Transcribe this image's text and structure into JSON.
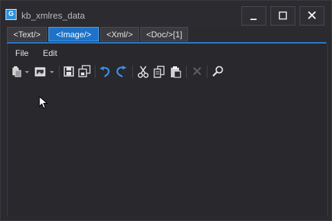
{
  "window": {
    "title": "kb_xmlres_data",
    "app_icon_letter": "G"
  },
  "tabs": [
    {
      "label": "<Text/>",
      "active": false
    },
    {
      "label": "<Image/>",
      "active": true
    },
    {
      "label": "<Xml/>",
      "active": false
    },
    {
      "label": "<Doc/>[1]",
      "active": false
    }
  ],
  "menu": {
    "file": "File",
    "edit": "Edit"
  },
  "toolbar": {
    "icons": [
      "paste-special-icon",
      "insert-image-icon",
      "save-icon",
      "save-all-icon",
      "undo-icon",
      "redo-icon",
      "cut-icon",
      "copy-icon",
      "paste-icon",
      "delete-icon",
      "find-icon"
    ]
  },
  "colors": {
    "accent": "#1e72c8",
    "background": "#28282d",
    "titlebar": "#2b2b30"
  }
}
